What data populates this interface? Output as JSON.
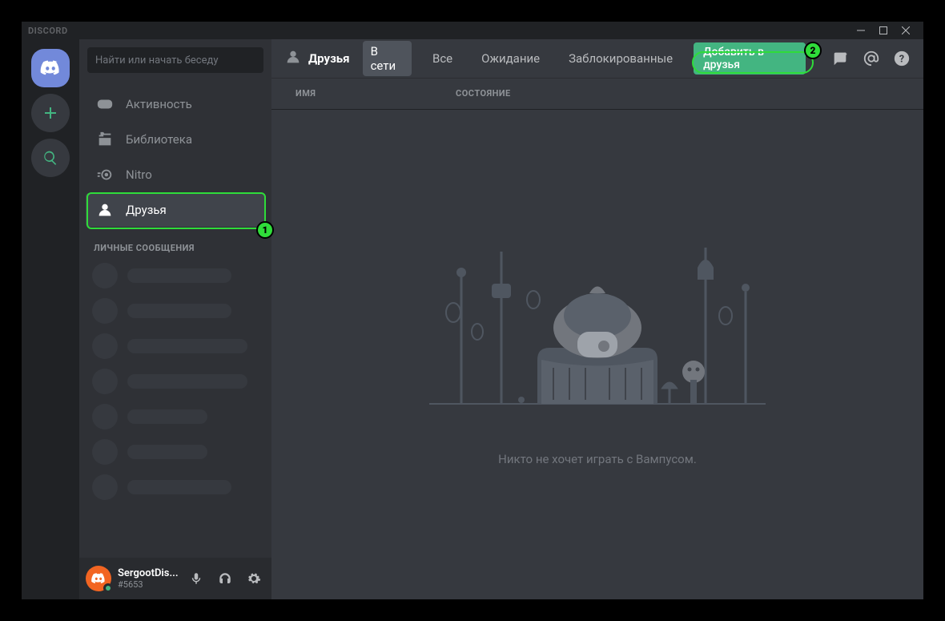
{
  "titlebar": {
    "title": "DISCORD"
  },
  "search": {
    "placeholder": "Найти или начать беседу"
  },
  "nav": {
    "activity": "Активность",
    "library": "Библиотека",
    "nitro": "Nitro",
    "friends": "Друзья"
  },
  "sections": {
    "dm_header": "ЛИЧНЫЕ СООБЩЕНИЯ"
  },
  "user": {
    "name": "SergootDis...",
    "tag": "#5653"
  },
  "topbar": {
    "title": "Друзья",
    "tab_online": "В сети",
    "tab_all": "Все",
    "tab_pending": "Ожидание",
    "tab_blocked": "Заблокированные",
    "add_friend": "Добавить в друзья"
  },
  "columns": {
    "name": "ИМЯ",
    "status": "СОСТОЯНИЕ"
  },
  "empty": {
    "text": "Никто не хочет играть с Вампусом."
  },
  "annotations": {
    "one": "1",
    "two": "2"
  }
}
